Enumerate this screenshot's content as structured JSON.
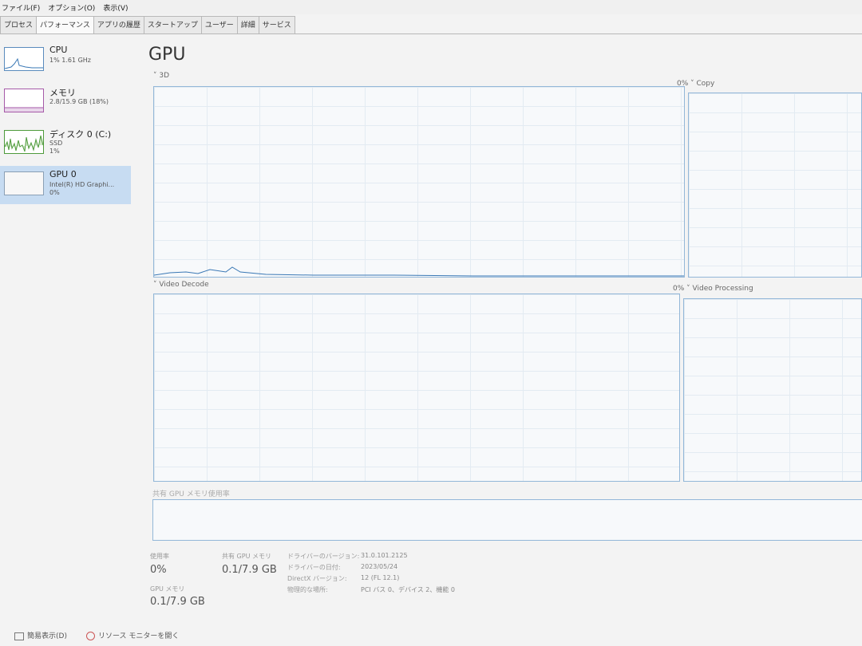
{
  "menu": [
    "ファイル(F)",
    "オプション(O)",
    "表示(V)"
  ],
  "tabs": [
    "プロセス",
    "パフォーマンス",
    "アプリの履歴",
    "スタートアップ",
    "ユーザー",
    "詳細",
    "サービス"
  ],
  "active_tab": "パフォーマンス",
  "sidebar": [
    {
      "name": "CPU",
      "sub": "1% 1.61 GHz",
      "sub2": ""
    },
    {
      "name": "メモリ",
      "sub": "2.8/15.9 GB (18%)",
      "sub2": ""
    },
    {
      "name": "ディスク 0 (C:)",
      "sub": "SSD",
      "sub2": "1%"
    },
    {
      "name": "GPU 0",
      "sub": "Intel(R) HD Graphi...",
      "sub2": "0%"
    }
  ],
  "main": {
    "title": "GPU",
    "engines": {
      "e3d": {
        "label": "3D"
      },
      "copy": {
        "label": "Copy",
        "pct": "0%"
      },
      "decode": {
        "label": "Video Decode"
      },
      "processing": {
        "label": "Video Processing",
        "pct": "0%"
      }
    },
    "shared_label": "共有 GPU メモリ使用率",
    "stats": {
      "util_label": "使用率",
      "util_value": "0%",
      "shared_label": "共有 GPU メモリ",
      "shared_value": "0.1/7.9 GB",
      "gpu_mem_label": "GPU メモリ",
      "gpu_mem_value": "0.1/7.9 GB"
    },
    "info": [
      {
        "k": "ドライバーのバージョン:",
        "v": "31.0.101.2125"
      },
      {
        "k": "ドライバーの日付:",
        "v": "2023/05/24"
      },
      {
        "k": "DirectX バージョン:",
        "v": "12 (FL 12.1)"
      },
      {
        "k": "物理的な場所:",
        "v": "PCI バス 0、デバイス 2、機能 0"
      }
    ]
  },
  "footer": {
    "brief": "簡易表示(D)",
    "monitor": "リソース モニターを開く"
  }
}
